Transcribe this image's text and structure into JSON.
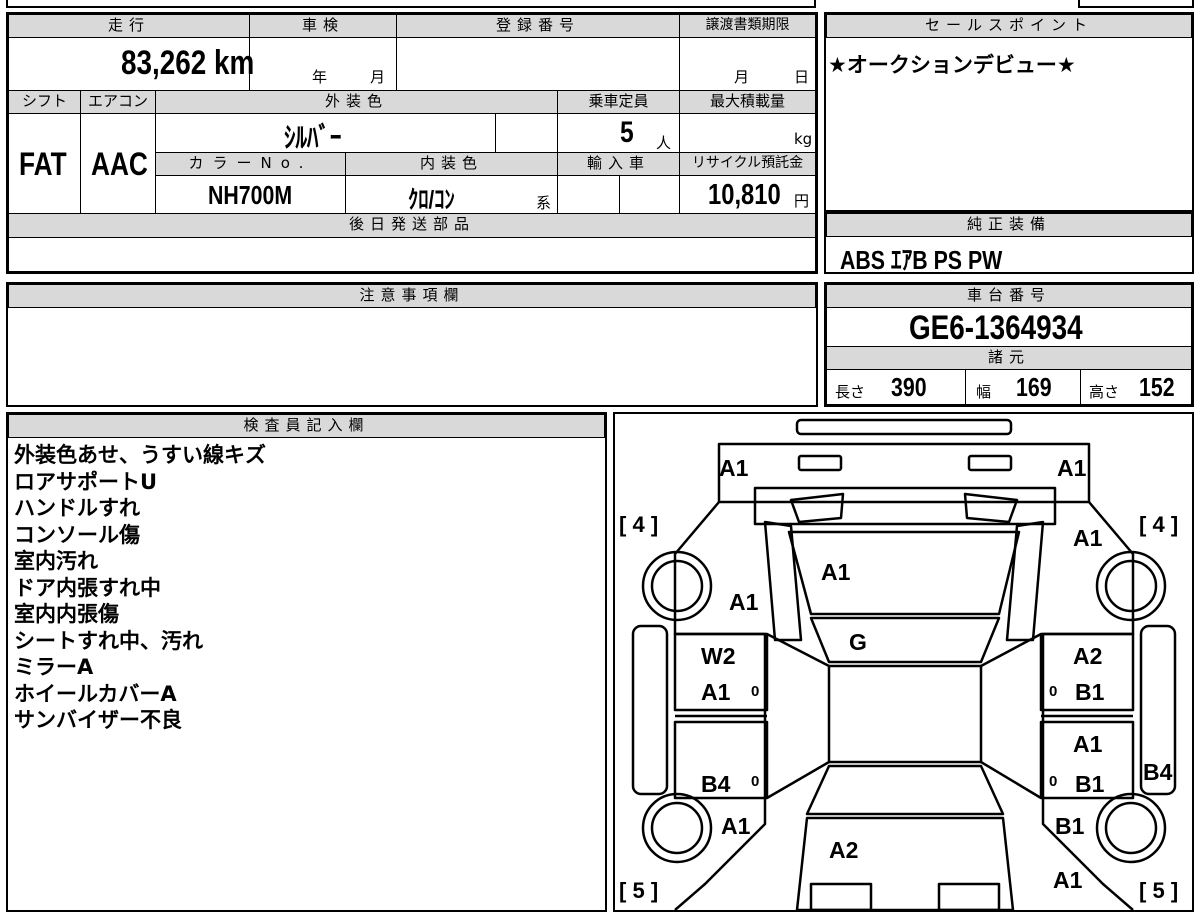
{
  "vehicle": {
    "headers": {
      "mileage": "走行",
      "inspection": "車検",
      "registration_no": "登録番号",
      "transfer_deadline": "譲渡書類期限",
      "shift": "シフト",
      "aircon": "エアコン",
      "exterior_color": "外装色",
      "capacity": "乗車定員",
      "max_load": "最大積載量",
      "color_no": "カラーNo.",
      "interior_color": "内装色",
      "import": "輸入車",
      "recycle_fee": "リサイクル預託金",
      "later_parts": "後日発送部品"
    },
    "mileage": "83,262 km",
    "inspection_year_unit": "年",
    "inspection_month_unit": "月",
    "deadline_month_unit": "月",
    "deadline_day_unit": "日",
    "shift": "FAT",
    "aircon": "AAC",
    "exterior_color": "ｼﾙﾊﾞｰ",
    "capacity": "5",
    "capacity_unit": "人",
    "max_load_unit": "kg",
    "color_no": "NH700M",
    "interior_color": "ｸﾛ/ｺﾝ",
    "interior_suffix": "系",
    "recycle_fee": "10,810",
    "recycle_unit": "円"
  },
  "sales": {
    "header": "セールスポイント",
    "text": "★オークションデビュー★"
  },
  "equipment": {
    "header": "純正装備",
    "text": "ABS ｴｱB PS PW"
  },
  "caution": {
    "header": "注意事項欄"
  },
  "chassis": {
    "header": "車台番号",
    "number": "GE6-1364934"
  },
  "specs": {
    "header": "諸元",
    "length_label": "長さ",
    "length": "390",
    "width_label": "幅",
    "width": "169",
    "height_label": "高さ",
    "height": "152"
  },
  "inspector": {
    "header": "検査員記入欄",
    "notes": [
      "外装色あせ、うすい線キズ",
      "ロアサポートU",
      "ハンドルすれ",
      "コンソール傷",
      "室内汚れ",
      "ドア内張すれ中",
      "室内内張傷",
      "シートすれ中、汚れ",
      "ミラーA",
      "ホイールカバーA",
      "サンバイザー不良"
    ]
  },
  "diagram": {
    "tire_left_front": "4",
    "tire_right_front": "4",
    "tire_left_rear": "5",
    "tire_right_rear": "5",
    "marks": {
      "bumper_front_left": "A1",
      "bumper_front_right": "A1",
      "fender_front_right": "A1",
      "hood": "A1",
      "fender_front_left": "A1",
      "windshield": "G",
      "door_front_left_top": "W2",
      "door_front_left_bottom": "A1",
      "door_front_right_top": "A2",
      "door_front_right_bottom": "B1",
      "door_rear_left": "B4",
      "door_rear_right_top": "A1",
      "door_rear_right_bottom": "B1",
      "rocker_right": "B4",
      "quarter_rear_left": "A1",
      "quarter_rear_right": "B1",
      "roof_rear": "A2",
      "bumper_rear_right": "A1",
      "zero": "0"
    }
  }
}
